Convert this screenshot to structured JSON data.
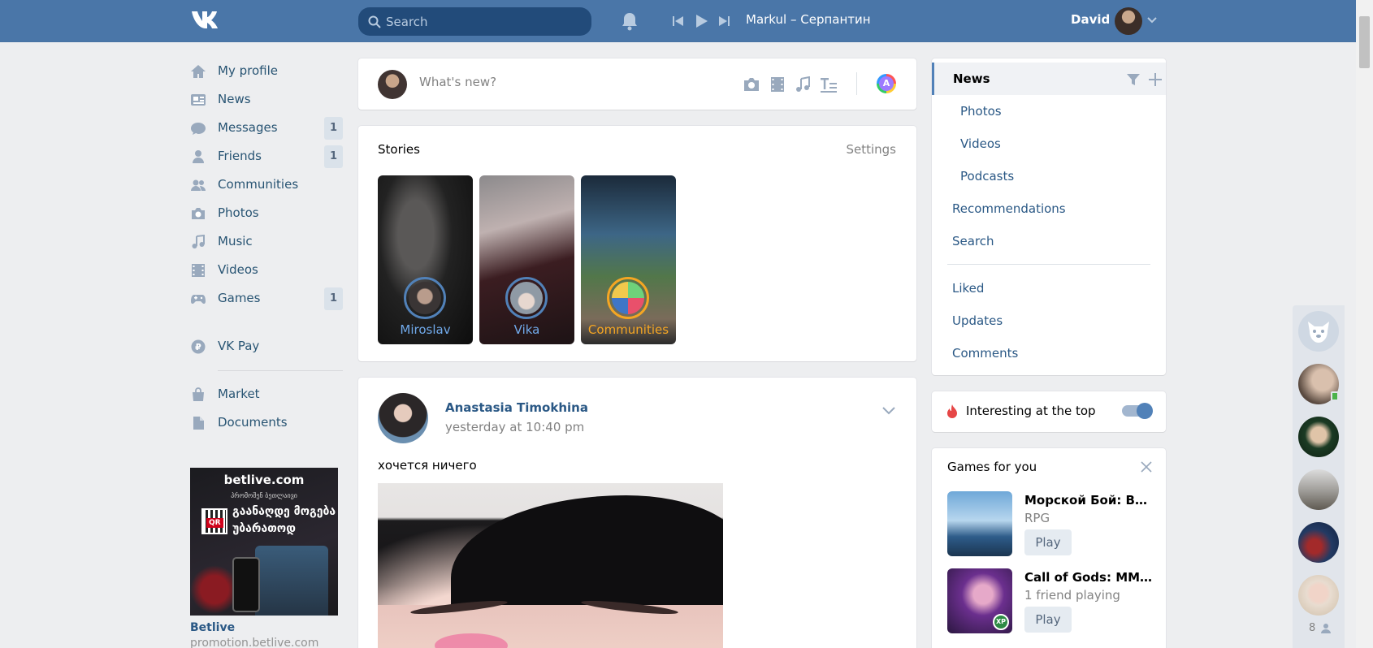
{
  "header": {
    "search_placeholder": "Search",
    "track": "Markul – Серпантин",
    "user_name": "David",
    "accent": "#4a76a8"
  },
  "nav": {
    "items": [
      {
        "label": "My profile",
        "icon": "home-icon"
      },
      {
        "label": "News",
        "icon": "news-icon"
      },
      {
        "label": "Messages",
        "icon": "messages-icon",
        "badge": "1"
      },
      {
        "label": "Friends",
        "icon": "friends-icon",
        "badge": "1"
      },
      {
        "label": "Communities",
        "icon": "communities-icon"
      },
      {
        "label": "Photos",
        "icon": "camera-icon"
      },
      {
        "label": "Music",
        "icon": "music-icon"
      },
      {
        "label": "Videos",
        "icon": "video-icon"
      },
      {
        "label": "Games",
        "icon": "gamepad-icon",
        "badge": "1"
      },
      {
        "label": "VK Pay",
        "icon": "vkpay-icon"
      },
      {
        "label": "Market",
        "icon": "bag-icon"
      },
      {
        "label": "Documents",
        "icon": "document-icon"
      }
    ]
  },
  "ad": {
    "brand": "betlive.com",
    "line_small": "პრომოშენ ბეთლაივი",
    "headline": "გაანაღდე მოგება უბარათოდ",
    "qr_tag": "QR",
    "title": "Betlive",
    "subtitle": "promotion.betlive.com"
  },
  "composer": {
    "placeholder": "What's new?",
    "avatar_letter": "A"
  },
  "stories": {
    "title": "Stories",
    "settings": "Settings",
    "items": [
      {
        "name": "Miroslav"
      },
      {
        "name": "Vika"
      },
      {
        "name": "Communities"
      }
    ]
  },
  "post": {
    "author": "Anastasia Timokhina",
    "time": "yesterday at 10:40 pm",
    "text": "хочется ничего"
  },
  "right_menu": {
    "selected": "News",
    "sub": [
      "Photos",
      "Videos",
      "Podcasts"
    ],
    "main": [
      "Recommendations",
      "Search"
    ],
    "extra": [
      "Liked",
      "Updates",
      "Comments"
    ]
  },
  "interesting": {
    "label": "Interesting at the top",
    "enabled": true
  },
  "games": {
    "title": "Games for you",
    "items": [
      {
        "name": "Морской Бой: Влас...",
        "sub": "RPG",
        "button": "Play"
      },
      {
        "name": "Call of Gods: MMOR...",
        "sub": "1 friend playing",
        "button": "Play",
        "badge": "XP"
      }
    ]
  },
  "friends_bar": {
    "online_count": "8"
  }
}
